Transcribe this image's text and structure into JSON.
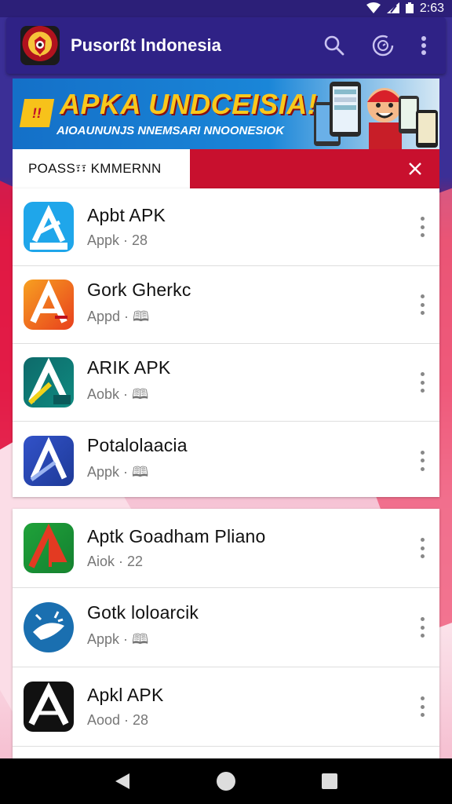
{
  "status_bar": {
    "time": "2:63",
    "icons": [
      "wifi-icon",
      "signal-icon",
      "battery-icon"
    ]
  },
  "app_bar": {
    "title": "Pusorßt lndonesia",
    "actions": [
      "search-icon",
      "clock-icon",
      "more-vert-icon"
    ]
  },
  "banner": {
    "title": "APKA UNDCEISIA!",
    "subtitle": "AIOAUNUNJS NNEMSARI NNOONESIOK"
  },
  "tabs": {
    "active_label": "POASS፣፣ KMMERNN"
  },
  "list1": [
    {
      "title": "Apbt APK",
      "subtitle": "Appk · 28",
      "icon_color": "#1fa6ea",
      "icon_label": "Iuoioos"
    },
    {
      "title": "Gork Gherkc",
      "subtitle": "Appd · 🕮",
      "icon_color": "#f0561e",
      "icon_label": "ƏQB"
    },
    {
      "title": "ARIK APK",
      "subtitle": "Aobk · 🕮",
      "icon_color": "#0f7a7a",
      "icon_label": "AGB"
    },
    {
      "title": "Potalolaacia",
      "subtitle": "Appk · 🕮",
      "icon_color": "#2a48b8",
      "icon_label": ""
    }
  ],
  "list2": [
    {
      "title": "Aptk Goadham Pliano",
      "subtitle": "Aiok · 22",
      "icon_color": "#1f9a3a",
      "icon_label": "AP"
    },
    {
      "title": "Gotk loloarcik",
      "subtitle": "Appk · 🕮",
      "icon_color": "#1a72b4",
      "icon_label": ""
    },
    {
      "title": "Apkl APK",
      "subtitle": "Aood · 28",
      "icon_color": "#111111",
      "icon_label": "AGB"
    }
  ],
  "nav": [
    "back-icon",
    "home-icon",
    "recents-icon"
  ]
}
